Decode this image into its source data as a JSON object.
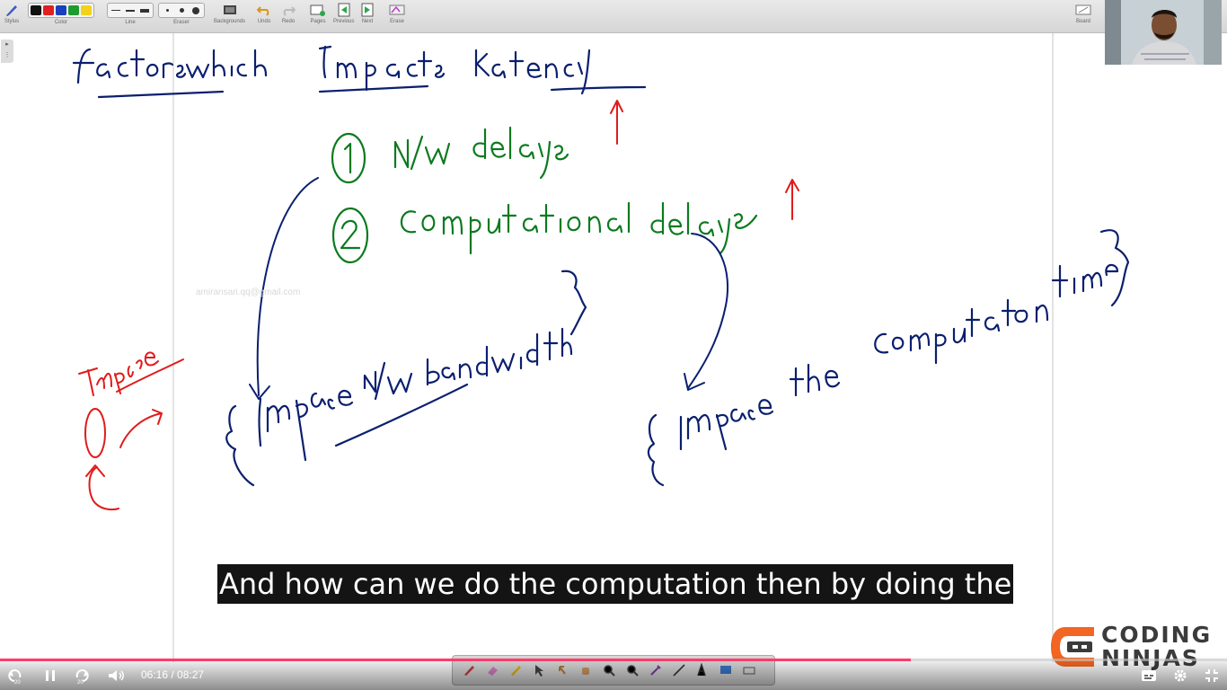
{
  "toolbar": {
    "groups": [
      {
        "label": "Stylus"
      },
      {
        "label": "Color"
      },
      {
        "label": "Line"
      },
      {
        "label": "Eraser"
      },
      {
        "label": "Backgrounds"
      },
      {
        "label": "Undo"
      },
      {
        "label": "Redo"
      },
      {
        "label": "Pages"
      },
      {
        "label": "Previous"
      },
      {
        "label": "Next"
      },
      {
        "label": "Erase"
      },
      {
        "label": "Board"
      }
    ],
    "colors": [
      "#111111",
      "#e02020",
      "#1a3fbf",
      "#1f9a2e",
      "#f2d21a"
    ]
  },
  "whiteboard": {
    "watermark": "amiransari.qq@gmail.com",
    "ink_colors": {
      "blue": "#0a1f6e",
      "green": "#0b7a1e",
      "red": "#e01b1b"
    }
  },
  "caption": {
    "text": "And how can we do the computation then by doing the"
  },
  "logo": {
    "line1": "CODING",
    "line2": "NINJAS",
    "accent": "#f26522"
  },
  "player": {
    "current_time": "06:16",
    "duration": "08:27",
    "time_display": "06:16 / 08:27",
    "progress_fraction": 0.742,
    "skip_back": "20",
    "skip_forward": "20"
  }
}
